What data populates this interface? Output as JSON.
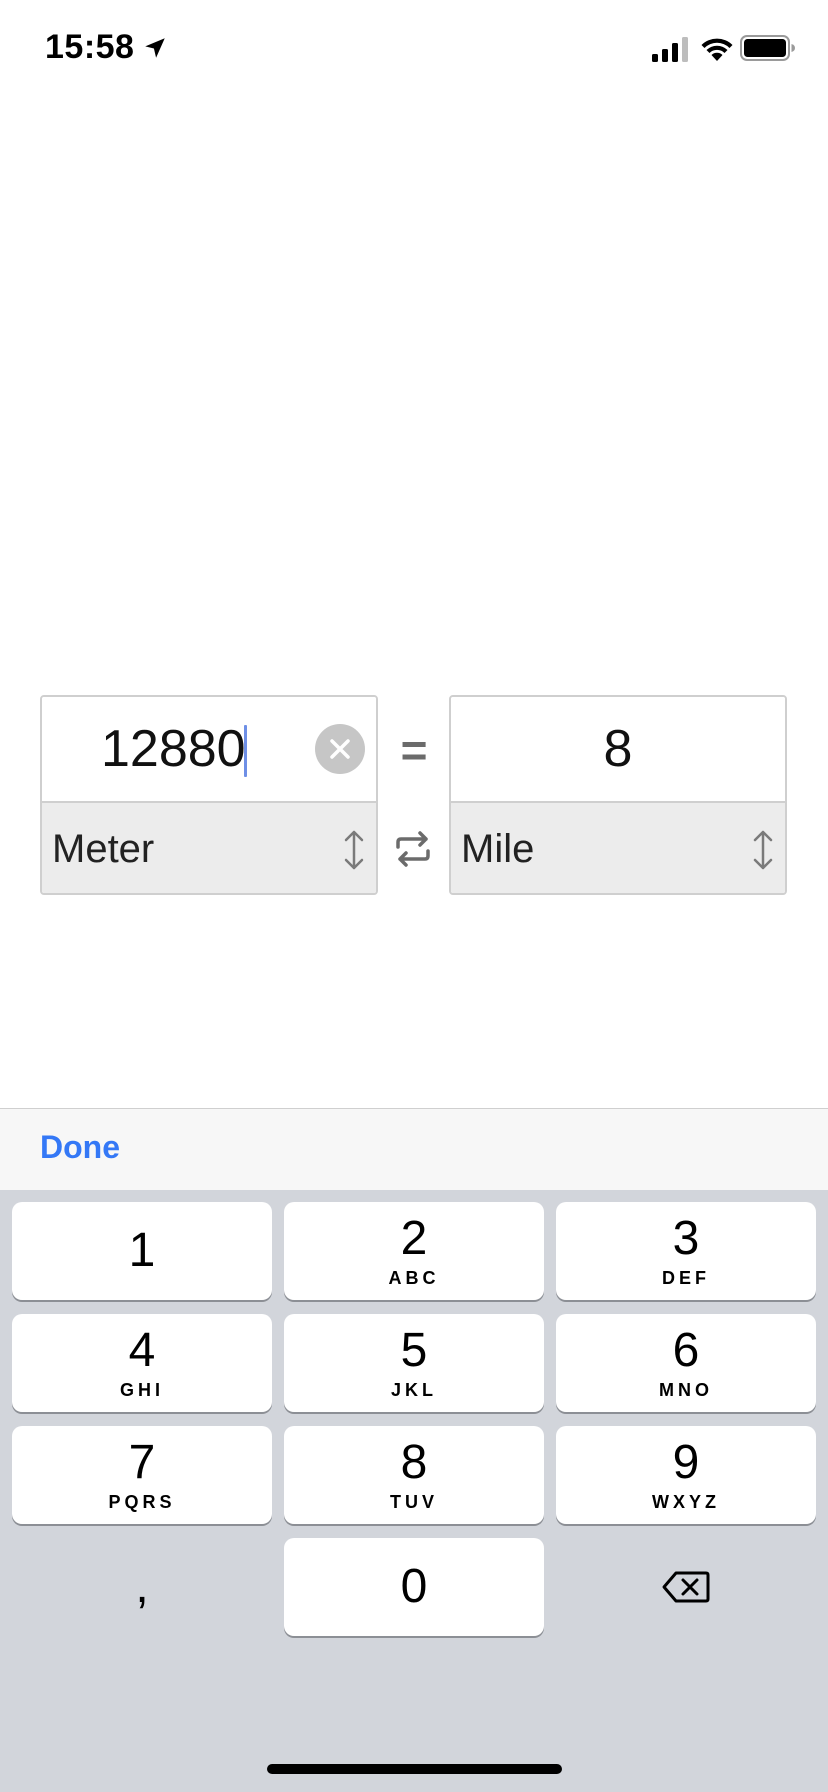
{
  "status_bar": {
    "time": "15:58"
  },
  "converter": {
    "from": {
      "value": "12880",
      "unit": "Meter"
    },
    "equals": "=",
    "to": {
      "value": "8",
      "unit": "Mile"
    }
  },
  "keyboard": {
    "done_label": "Done",
    "keys": [
      {
        "digit": "1",
        "letters": ""
      },
      {
        "digit": "2",
        "letters": "ABC"
      },
      {
        "digit": "3",
        "letters": "DEF"
      },
      {
        "digit": "4",
        "letters": "GHI"
      },
      {
        "digit": "5",
        "letters": "JKL"
      },
      {
        "digit": "6",
        "letters": "MNO"
      },
      {
        "digit": "7",
        "letters": "PQRS"
      },
      {
        "digit": "8",
        "letters": "TUV"
      },
      {
        "digit": "9",
        "letters": "WXYZ"
      },
      {
        "digit": "0",
        "letters": ""
      }
    ],
    "comma_label": ","
  },
  "icons": {
    "location": "location-arrow-icon",
    "signal": "cellular-signal-icon",
    "wifi": "wifi-icon",
    "battery": "battery-icon",
    "clear": "clear-circle-icon",
    "unit_picker": "up-down-arrows-icon",
    "swap": "swap-arrows-icon",
    "backspace": "backspace-icon"
  },
  "colors": {
    "accent": "#3478f6",
    "caret": "#6e8fe6",
    "keypad_background": "#d2d5db",
    "unit_row_background": "#ececec"
  }
}
